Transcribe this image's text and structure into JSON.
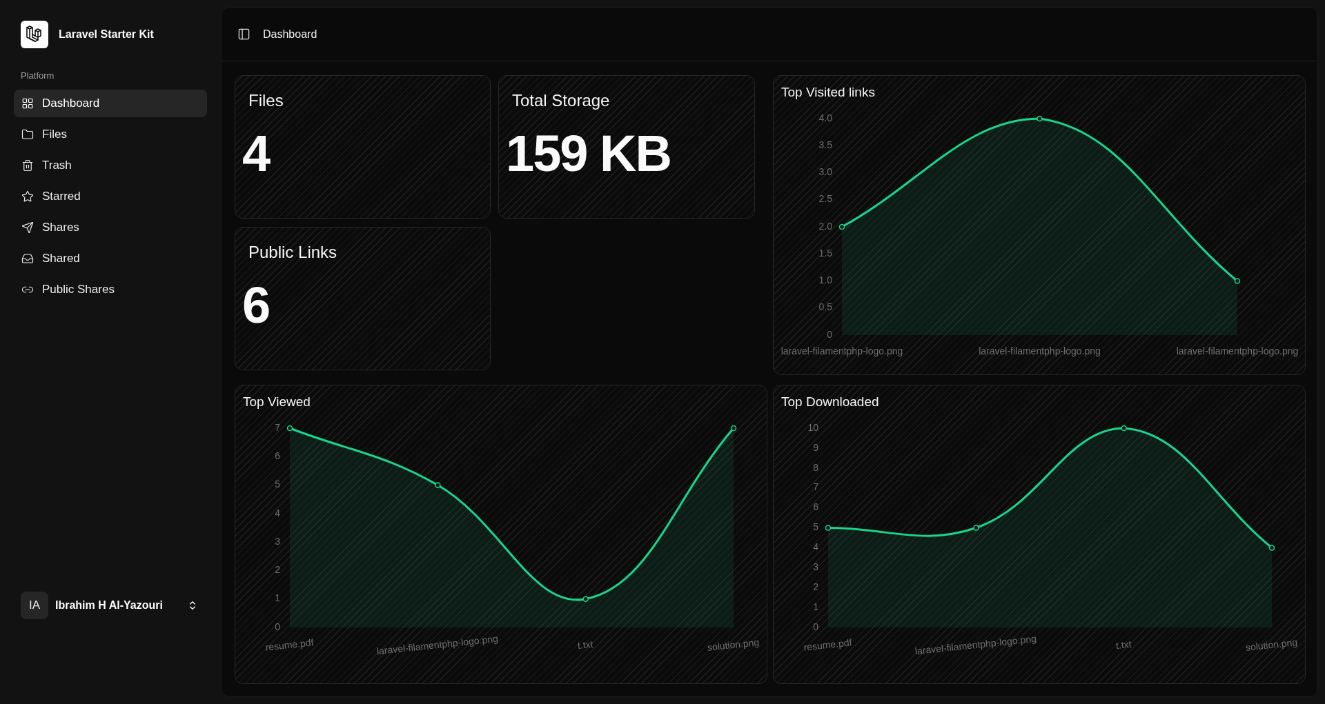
{
  "sidebar": {
    "app_name": "Laravel Starter Kit",
    "section_label": "Platform",
    "items": [
      {
        "label": "Dashboard",
        "selected": true
      },
      {
        "label": "Files",
        "selected": false
      },
      {
        "label": "Trash",
        "selected": false
      },
      {
        "label": "Starred",
        "selected": false
      },
      {
        "label": "Shares",
        "selected": false
      },
      {
        "label": "Shared",
        "selected": false
      },
      {
        "label": "Public Shares",
        "selected": false
      }
    ],
    "user": {
      "initials": "IA",
      "name": "Ibrahim H Al-Yazouri"
    }
  },
  "header": {
    "breadcrumb": "Dashboard"
  },
  "stats": [
    {
      "label": "Files",
      "value": "4"
    },
    {
      "label": "Total Storage",
      "value": "159 KB"
    },
    {
      "label": "Public Links",
      "value": "6"
    }
  ],
  "charts": [
    {
      "chart_data": {
        "type": "area",
        "title": "Top Visited links",
        "categories": [
          "laravel-filamentphp-logo.png",
          "laravel-filamentphp-logo.png",
          "laravel-filamentphp-logo.png"
        ],
        "series": [
          {
            "color": "#18d68c",
            "values": [
              2,
              4,
              1
            ]
          }
        ],
        "ylim": [
          0,
          4
        ],
        "yticks": [
          0,
          {
            "value": 0.5,
            "label": "0.5"
          },
          {
            "value": 1,
            "label": "1.0"
          },
          {
            "value": 1.5,
            "label": "1.5"
          },
          {
            "value": 2,
            "label": "2.0"
          },
          {
            "value": 2.5,
            "label": "2.5"
          },
          {
            "value": 3,
            "label": "3.0"
          },
          {
            "value": 3.5,
            "label": "3.5"
          },
          {
            "value": 4,
            "label": "4.0"
          }
        ]
      }
    },
    {
      "chart_data": {
        "type": "area",
        "title": "Top Viewed",
        "categories": [
          "resume.pdf",
          "laravel-filamentphp-logo.png",
          "t.txt",
          "solution.png"
        ],
        "series": [
          {
            "color": "#18d68c",
            "values": [
              7,
              5,
              1,
              7
            ]
          }
        ],
        "ylim": [
          0,
          7
        ],
        "yticks": [
          0,
          1,
          2,
          3,
          4,
          5,
          6,
          7
        ]
      }
    },
    {
      "chart_data": {
        "type": "area",
        "title": "Top Downloaded",
        "categories": [
          "resume.pdf",
          "laravel-filamentphp-logo.png",
          "t.txt",
          "solution.png"
        ],
        "series": [
          {
            "color": "#18d68c",
            "values": [
              5,
              5,
              10,
              4
            ]
          }
        ],
        "ylim": [
          0,
          10
        ],
        "yticks": [
          0,
          1,
          2,
          3,
          4,
          5,
          6,
          7,
          8,
          9,
          10
        ]
      }
    }
  ]
}
